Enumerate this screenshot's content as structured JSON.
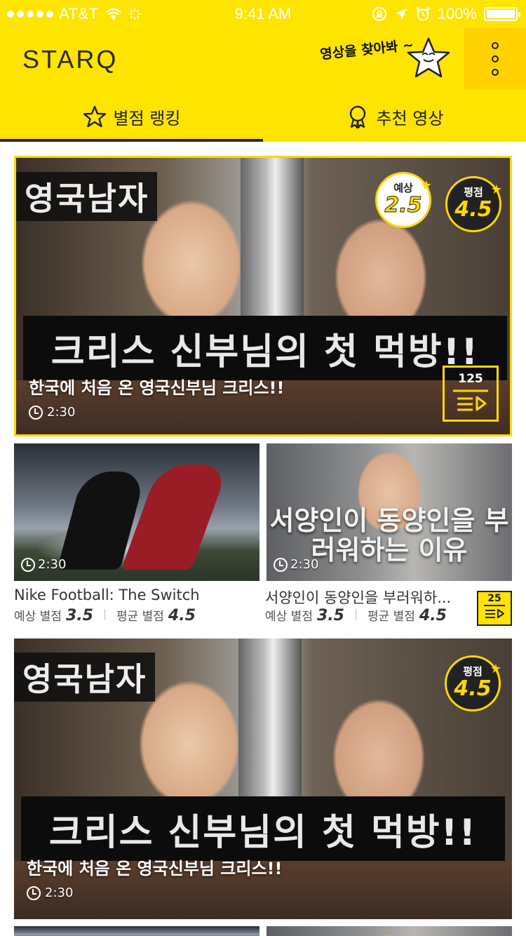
{
  "status_bar": {
    "carrier": "AT&T",
    "time": "9:41 AM",
    "battery": "100%"
  },
  "app_bar": {
    "logo": "STARQ",
    "search_hint": "영상을 찾아봐 ~"
  },
  "tabs": [
    {
      "label": "별점 랭킹",
      "active": true,
      "icon": "star-icon"
    },
    {
      "label": "추천 영상",
      "active": false,
      "icon": "medal-icon"
    }
  ],
  "featured": {
    "thumbnail_top_text": "영국남자",
    "thumbnail_caption": "크리스 신부님의 첫 먹방!!",
    "title": "한국에 처음 온 영국신부님 크리스!!",
    "duration": "2:30",
    "expected_label": "예상",
    "expected_value": "2.5",
    "average_label": "평점",
    "average_value": "4.5",
    "playlist_count": "125"
  },
  "grid": [
    {
      "title": "Nike Football: The Switch",
      "duration": "2:30",
      "expected_label": "예상 별점",
      "expected_value": "3.5",
      "average_label": "평균 별점",
      "average_value": "4.5"
    },
    {
      "title": "서양인이 동양인을 부러워하...",
      "thumbnail_caption": "서양인이 동양인을 부러워하는 이유",
      "duration": "2:30",
      "expected_label": "예상 별점",
      "expected_value": "3.5",
      "average_label": "평균 별점",
      "average_value": "4.5",
      "playlist_count": "25"
    }
  ],
  "featured2": {
    "thumbnail_top_text": "영국남자",
    "thumbnail_caption": "크리스 신부님의 첫 먹방!!",
    "title": "한국에 처음 온 영국신부님 크리스!!",
    "duration": "2:30",
    "average_label": "평점",
    "average_value": "4.5"
  },
  "colors": {
    "brand_yellow": "#FFE400",
    "accent_yellow": "#FFD800",
    "dark": "#222222"
  }
}
